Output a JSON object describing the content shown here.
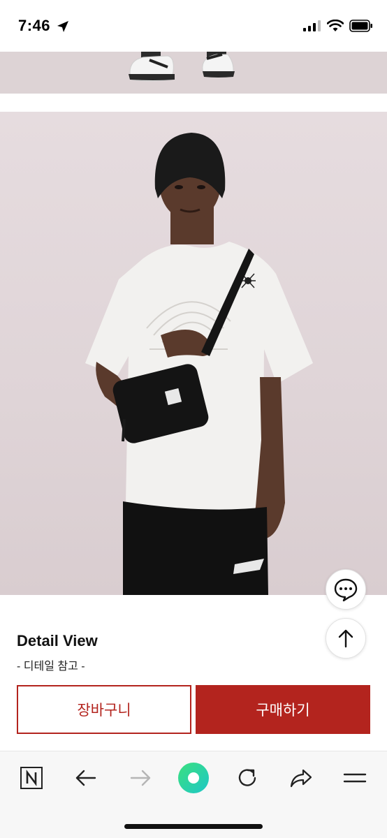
{
  "status_bar": {
    "time": "7:46",
    "icons": [
      "location-arrow-icon",
      "cellular-signal-icon",
      "wifi-icon",
      "battery-icon"
    ]
  },
  "product_images": [
    "sneakers-photo",
    "model-tshirt-photo"
  ],
  "floating_buttons": {
    "chat_icon": "chat-bubble-icon",
    "top_icon": "arrow-up-icon"
  },
  "detail": {
    "title": "Detail View",
    "subtitle": "- 디테일 참고 -"
  },
  "actions": {
    "cart_label": "장바구니",
    "buy_label": "구매하기"
  },
  "browser_nav": {
    "items": [
      "naver-n-icon",
      "back-arrow-icon",
      "forward-arrow-icon",
      "green-dot-icon",
      "refresh-icon",
      "share-icon",
      "menu-icon"
    ]
  },
  "colors": {
    "accent": "#b3241e",
    "green_button": "#2ed3a2",
    "photo_background": "#e0d6d9"
  }
}
